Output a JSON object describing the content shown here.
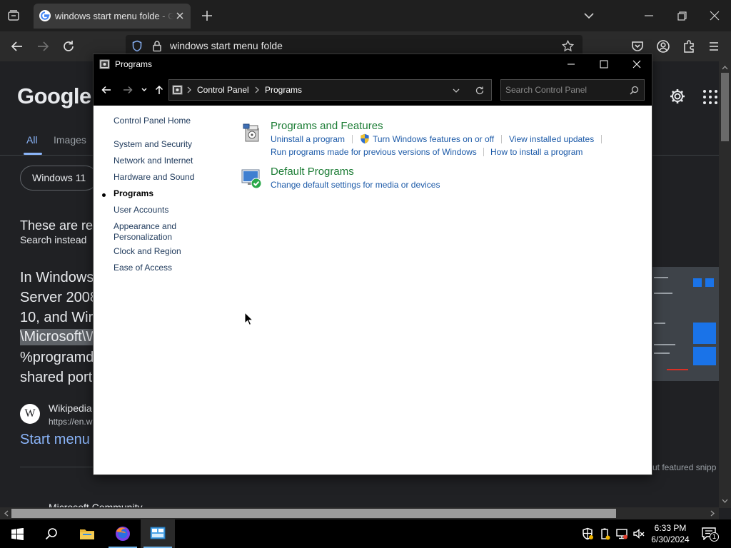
{
  "browser": {
    "tab_title": "windows start menu folde - Google Search",
    "address_text": "windows start menu folde"
  },
  "google": {
    "logo": "Google",
    "tabs": [
      "All",
      "Images"
    ],
    "chip": "Windows 11",
    "heading": "These are re",
    "search_instead": "Search instead",
    "snippet_lines": [
      "In Windows",
      "Server 2008",
      "10, and Wir",
      "\\Microsoft\\W",
      "%programd",
      "shared port"
    ],
    "source_name": "Wikipedia",
    "source_url": "https://en.w",
    "result_link": "Start menu",
    "feedback_text": "ut featured snipp",
    "next_result": "Microsoft Community"
  },
  "control_panel": {
    "window_title": "Programs",
    "breadcrumb": [
      "Control Panel",
      "Programs"
    ],
    "search_placeholder": "Search Control Panel",
    "sidebar": {
      "home": "Control Panel Home",
      "items": [
        "System and Security",
        "Network and Internet",
        "Hardware and Sound",
        "Programs",
        "User Accounts",
        "Appearance and Personalization",
        "Clock and Region",
        "Ease of Access"
      ],
      "current_index": 3
    },
    "categories": [
      {
        "title": "Programs and Features",
        "icon": "programs-features-icon",
        "tasks": [
          "Uninstall a program",
          "Turn Windows features on or off",
          "View installed updates",
          "Run programs made for previous versions of Windows",
          "How to install a program"
        ]
      },
      {
        "title": "Default Programs",
        "icon": "default-programs-icon",
        "tasks": [
          "Change default settings for media or devices"
        ]
      }
    ]
  },
  "taskbar": {
    "time": "6:33 PM",
    "date": "6/30/2024",
    "notification_count": "1"
  },
  "colors": {
    "category_title": "#1d7d36",
    "task_link": "#1c5aa8",
    "sidebar_link": "#1e395b",
    "google_link": "#8ab4f8"
  }
}
